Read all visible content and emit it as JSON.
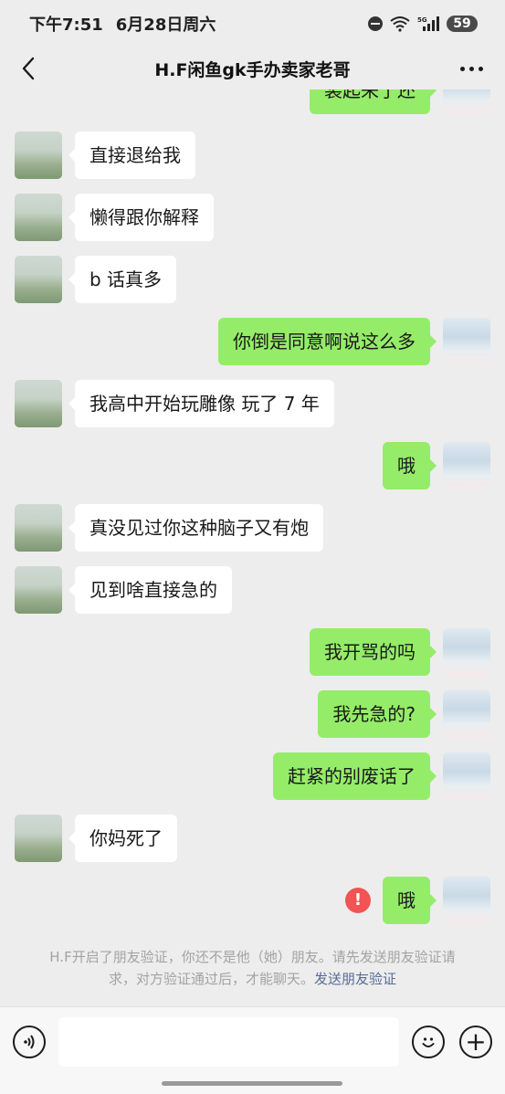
{
  "status_bar": {
    "time": "下午7:51",
    "date": "6月28日周六",
    "battery": "59",
    "network": "5G"
  },
  "header": {
    "title": "H.F闲鱼gk手办卖家老哥",
    "back_icon": "chevron-left-icon",
    "more_icon": "more-dots-icon"
  },
  "messages": [
    {
      "side": "right",
      "text": "装起来了还"
    },
    {
      "side": "left",
      "text": "直接退给我"
    },
    {
      "side": "left",
      "text": "懒得跟你解释"
    },
    {
      "side": "left",
      "text": "b 话真多"
    },
    {
      "side": "right",
      "text": "你倒是同意啊说这么多"
    },
    {
      "side": "left",
      "text": "我高中开始玩雕像 玩了 7 年"
    },
    {
      "side": "right",
      "text": "哦"
    },
    {
      "side": "left",
      "text": "真没见过你这种脑子又有炮"
    },
    {
      "side": "left",
      "text": "见到啥直接急的"
    },
    {
      "side": "right",
      "text": "我开骂的吗"
    },
    {
      "side": "right",
      "text": "我先急的?"
    },
    {
      "side": "right",
      "text": "赶紧的别废话了"
    },
    {
      "side": "left",
      "text": "你妈死了"
    },
    {
      "side": "right",
      "text": "哦",
      "failed": true,
      "failed_mark": "!"
    }
  ],
  "system_note": {
    "text": "H.F开启了朋友验证，你还不是他（她）朋友。请先发送朋友验证请求，对方验证通过后，才能聊天。",
    "link": "发送朋友验证"
  },
  "input_bar": {
    "voice_icon": "voice-icon",
    "emoji_icon": "emoji-icon",
    "plus_icon": "plus-icon",
    "plus_glyph": "+",
    "input_value": ""
  },
  "colors": {
    "background": "#ededed",
    "bubble_self": "#95ec69",
    "bubble_other": "#ffffff",
    "error": "#f25353",
    "link": "#576b95"
  }
}
